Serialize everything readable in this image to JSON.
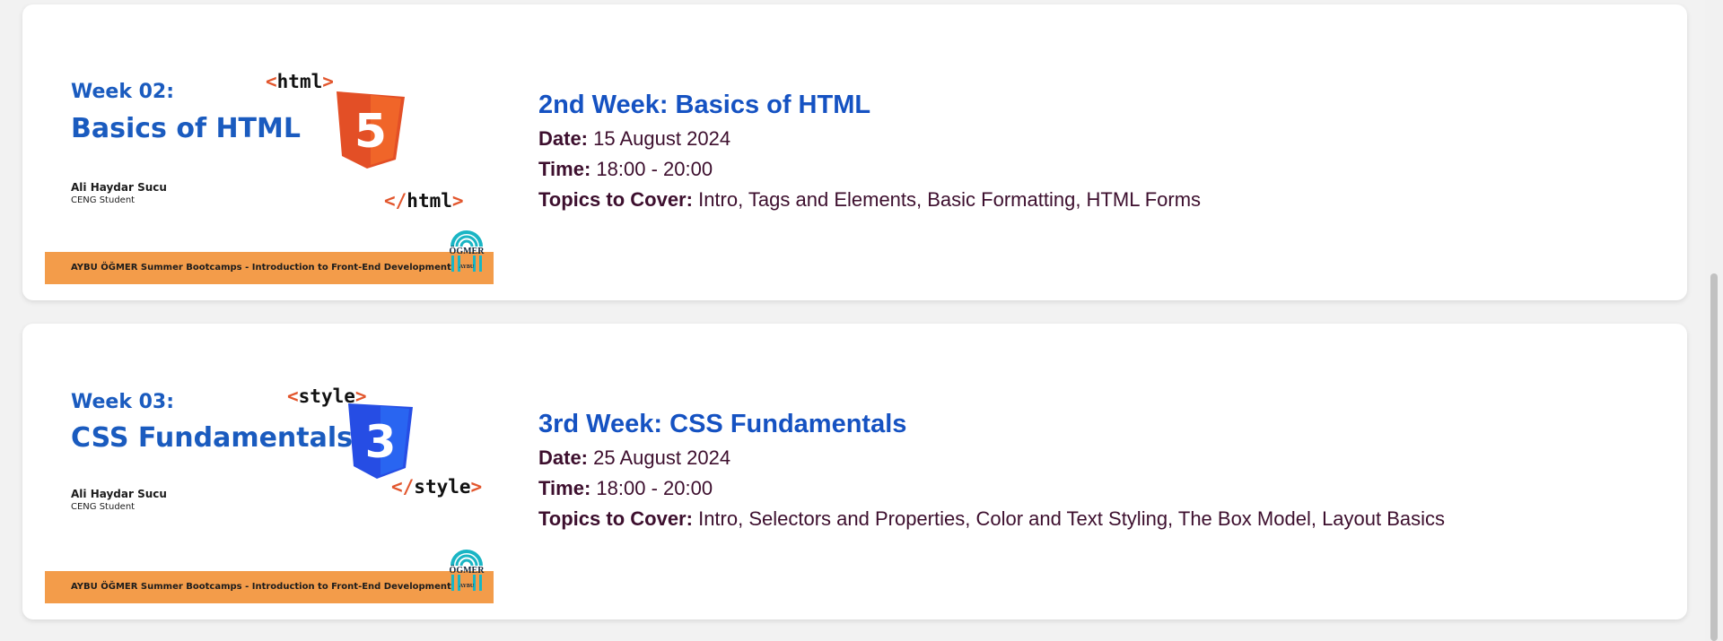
{
  "weeks": [
    {
      "thumb": {
        "week_label": "Week 02:",
        "title": "Basics of HTML",
        "open_tag_lt": "<",
        "open_tag_name": "html",
        "open_tag_gt": ">",
        "close_tag_lt": "</",
        "close_tag_name": "html",
        "close_tag_gt": ">",
        "shield_number": "5",
        "shield_color": "#e34f26",
        "author": "Ali Haydar Sucu",
        "role": "CENG Student",
        "banner": "AYBU ÖĞMER Summer Bootcamps - Introduction to Front-End Development",
        "logo_top": "ÖGMER",
        "logo_bottom": "AYBU"
      },
      "heading": "2nd Week: Basics of HTML",
      "date_label": "Date:",
      "date": "15 August 2024",
      "time_label": "Time:",
      "time": "18:00 - 20:00",
      "topics_label": "Topics to Cover:",
      "topics": "Intro, Tags and Elements, Basic Formatting, HTML Forms"
    },
    {
      "thumb": {
        "week_label": "Week 03:",
        "title": "CSS Fundamentals",
        "open_tag_lt": "<",
        "open_tag_name": "style",
        "open_tag_gt": ">",
        "close_tag_lt": "</",
        "close_tag_name": "style",
        "close_tag_gt": ">",
        "shield_number": "3",
        "shield_color": "#264de4",
        "author": "Ali Haydar Sucu",
        "role": "CENG Student",
        "banner": "AYBU ÖĞMER Summer Bootcamps - Introduction to Front-End Development",
        "logo_top": "ÖGMER",
        "logo_bottom": "AYBU"
      },
      "heading": "3rd Week: CSS Fundamentals",
      "date_label": "Date:",
      "date": "25 August 2024",
      "time_label": "Time:",
      "time": "18:00 - 20:00",
      "topics_label": "Topics to Cover:",
      "topics": "Intro, Selectors and Properties, Color and Text Styling, The Box Model, Layout Basics"
    }
  ]
}
